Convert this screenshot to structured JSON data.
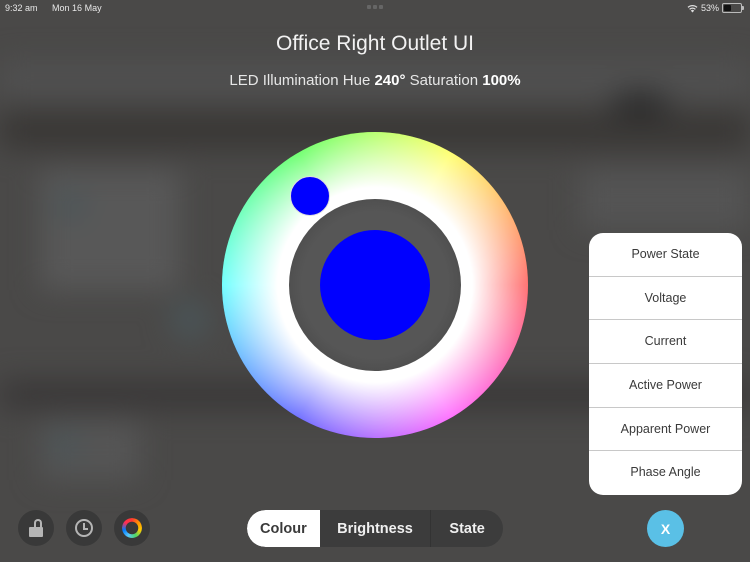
{
  "status_bar": {
    "time": "9:32 am",
    "date": "Mon 16 May",
    "battery_percent": "53%",
    "battery_level": 0.53
  },
  "header": {
    "title": "Office Right Outlet UI",
    "subtitle_prefix": "LED Illumination Hue",
    "hue_value": "240°",
    "saturation_label": "Saturation",
    "saturation_value": "100%"
  },
  "color_wheel": {
    "hue_degrees": 240,
    "saturation_percent": 100,
    "selected_color": "#0000ff"
  },
  "popup_menu": {
    "items": [
      {
        "label": "Power State"
      },
      {
        "label": "Voltage"
      },
      {
        "label": "Current"
      },
      {
        "label": "Active Power"
      },
      {
        "label": "Apparent Power"
      },
      {
        "label": "Phase Angle"
      }
    ]
  },
  "bottom_bar": {
    "left_buttons": [
      {
        "icon": "unlock-icon"
      },
      {
        "icon": "clock-icon"
      },
      {
        "icon": "color-ring-icon"
      }
    ],
    "tabs": [
      {
        "label": "Colour",
        "active": true
      },
      {
        "label": "Brightness",
        "active": false
      },
      {
        "label": "State",
        "active": false
      }
    ],
    "close_label": "X",
    "close_color": "#5ac0e6"
  }
}
